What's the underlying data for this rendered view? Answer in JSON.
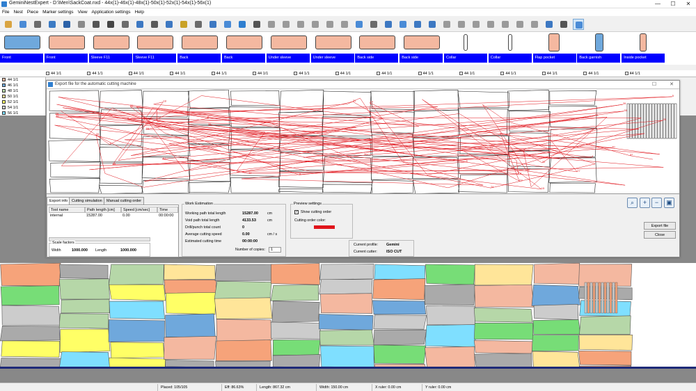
{
  "window": {
    "title": "GeminiNestExpert - D:\\Men\\SackCoat.nxd - 44x(1)-46x(1)-48x(1)-50x(1)-52x(1)-54x(1)-56x(1)",
    "minimize": "—",
    "maximize": "☐",
    "close": "✕"
  },
  "menu": [
    "File",
    "Nest",
    "Piece",
    "Marker settings",
    "View",
    "Application settings",
    "Help"
  ],
  "toolbar_icons": [
    "open-folder-icon",
    "open-file-icon",
    "save-icon",
    "save-as-icon",
    "undo-icon",
    "redo-icon",
    "select-icon",
    "place-icon",
    "print-icon",
    "piece-icon",
    "user-icon",
    "export-icon",
    "tool-icon",
    "settings-icon",
    "nest-icon",
    "layout-icon",
    "report-icon",
    "grid-icon",
    "arrange-icon",
    "rotate-icon",
    "flip-icon",
    "move-icon",
    "align-icon",
    "cut-icon",
    "plot-icon",
    "image-icon",
    "marker-icon",
    "preview-icon",
    "table-icon",
    "list-icon",
    "group-icon",
    "split-icon",
    "copy-icon",
    "zoom-icon",
    "info-icon",
    "layers-icon",
    "measure-icon",
    "search-icon",
    "print-preview-icon",
    "crosshair-icon"
  ],
  "pieces": [
    {
      "label": "Front",
      "color": "#6fa8dc"
    },
    {
      "label": "Front",
      "color": "#f4b8a0"
    },
    {
      "label": "Sleeve F11",
      "color": "#f4b8a0"
    },
    {
      "label": "Sleeve F11",
      "color": "#f4b8a0"
    },
    {
      "label": "Back",
      "color": "#f4b8a0"
    },
    {
      "label": "Back",
      "color": "#f4b8a0"
    },
    {
      "label": "Under sleeve",
      "color": "#f4b8a0"
    },
    {
      "label": "Under sleeve",
      "color": "#f4b8a0"
    },
    {
      "label": "Back side",
      "color": "#f4b8a0"
    },
    {
      "label": "Back side",
      "color": "#f4b8a0"
    },
    {
      "label": "Collar",
      "color": "#f4b8a0"
    },
    {
      "label": "Collar",
      "color": "#f4b8a0"
    },
    {
      "label": "Flap pocket",
      "color": "#f4b8a0"
    },
    {
      "label": "Back garnish",
      "color": "#6fa8dc"
    },
    {
      "label": "Inside pocket",
      "color": "#f4b8a0"
    }
  ],
  "piece_qty": {
    "size": "44",
    "count": "1/1"
  },
  "sizes": [
    {
      "size": "44",
      "qty": "1/1",
      "color": "#f4b8a0"
    },
    {
      "size": "46",
      "qty": "1/1",
      "color": "#6fa8dc"
    },
    {
      "size": "48",
      "qty": "1/1",
      "color": "#b6d7a8"
    },
    {
      "size": "50",
      "qty": "1/1",
      "color": "#ffe599"
    },
    {
      "size": "52",
      "qty": "1/1",
      "color": "#ffff66"
    },
    {
      "size": "54",
      "qty": "1/1",
      "color": "#cccccc"
    },
    {
      "size": "56",
      "qty": "1/1",
      "color": "#7fdfff"
    }
  ],
  "dialog": {
    "title": "Export file for the automatic cutting machine",
    "tabs": [
      "Export info",
      "Cutting simulation",
      "Manual cutting order"
    ],
    "table_headers": [
      "Tool name",
      "Path length [cm]",
      "Speed [cm/sec]",
      "Time"
    ],
    "table_row": [
      "internal",
      "15287.00",
      "0.00",
      "00:00:00"
    ],
    "scale_label": "Scale factors",
    "width_label": "Width",
    "width_value": "1000.000",
    "length_label": "Length",
    "length_value": "1000.000",
    "work_estimation": {
      "title": "Work Estimation",
      "rows": [
        {
          "label": "Working path total length",
          "value": "15287.00",
          "unit": "cm"
        },
        {
          "label": "Void path total length",
          "value": "4133.53",
          "unit": "cm"
        },
        {
          "label": "Drill/punch total count",
          "value": "0",
          "unit": ""
        },
        {
          "label": "Average cutting speed",
          "value": "0.00",
          "unit": "cm / s"
        },
        {
          "label": "Estimated cutting time",
          "value": "00:00:00",
          "unit": ""
        }
      ],
      "copies_label": "Number of copies:",
      "copies_value": "1"
    },
    "preview_settings": {
      "title": "Preview settings",
      "show_order_label": "Show cutting order",
      "order_color_label": "Cutting order color:",
      "order_color": "#e0141b"
    },
    "profile": {
      "profile_label": "Current profile:",
      "profile_value": "Gemini",
      "cutter_label": "Current cutter:",
      "cutter_value": "ISO CUT"
    },
    "export_button": "Export file",
    "close_button": "Close"
  },
  "status": {
    "placed": "Placed: 105/105",
    "eff": "Eff: 86.63%",
    "length": "Length: 867.32 cm",
    "width": "Width: 150.00 cm",
    "xruler": "X ruler: 0.00 cm",
    "yruler": "Y ruler: 0.00 cm"
  },
  "marker_colors": [
    "#f4b8a0",
    "#6fa8dc",
    "#b6d7a8",
    "#ffe599",
    "#ffff66",
    "#cccccc",
    "#7fdfff",
    "#77dd77",
    "#f6a37a",
    "#aaaaaa"
  ]
}
